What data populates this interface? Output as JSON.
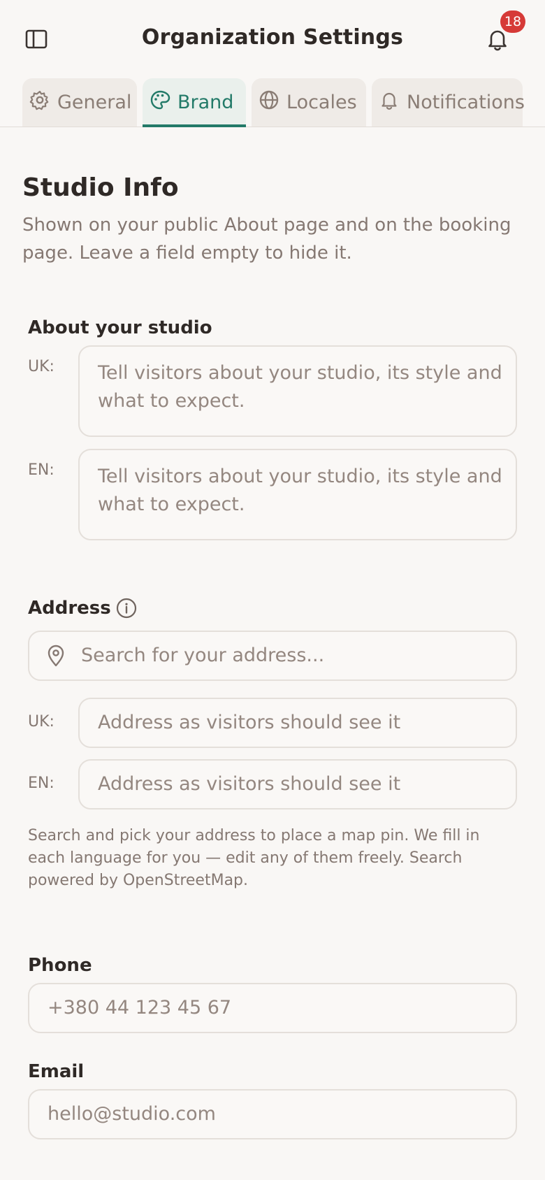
{
  "header": {
    "title": "Organization Settings",
    "sidebar_icon": "sidebar-toggle-icon",
    "bell_icon": "bell-icon",
    "notification_count": "18"
  },
  "tabs": [
    {
      "label": "General",
      "icon": "gear-icon",
      "active": false
    },
    {
      "label": "Brand",
      "icon": "palette-icon",
      "active": true
    },
    {
      "label": "Locales",
      "icon": "globe-icon",
      "active": false
    },
    {
      "label": "Notifications",
      "icon": "bell-icon",
      "active": false
    }
  ],
  "section": {
    "title": "Studio Info",
    "description": "Shown on your public About page and on the booking page. Leave a field empty to hide it."
  },
  "about": {
    "label": "About your studio",
    "uk_label": "UK:",
    "uk_placeholder": "Tell visitors about your studio, its style and what to expect.",
    "en_label": "EN:",
    "en_placeholder": "Tell visitors about your studio, its style and what to expect."
  },
  "address": {
    "label": "Address",
    "info_icon": "info-icon",
    "search_icon": "map-pin-icon",
    "search_placeholder": "Search for your address...",
    "uk_label": "UK:",
    "uk_placeholder": "Address as visitors should see it",
    "en_label": "EN:",
    "en_placeholder": "Address as visitors should see it",
    "help": "Search and pick your address to place a map pin. We fill in each language for you — edit any of them freely. Search powered by OpenStreetMap."
  },
  "phone": {
    "label": "Phone",
    "placeholder": "+380 44 123 45 67"
  },
  "email": {
    "label": "Email",
    "placeholder": "hello@studio.com"
  },
  "colors": {
    "accent": "#237a68",
    "badge": "#d63a37",
    "background": "#f9f7f5"
  }
}
